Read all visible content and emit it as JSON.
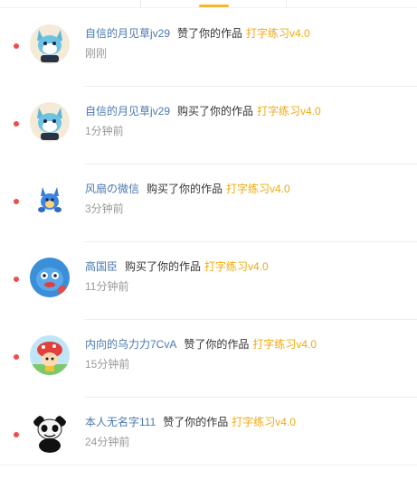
{
  "notifications": [
    {
      "username": "自信的月见草jv29",
      "action": "赞了你的作品",
      "work": "打字练习v4.0",
      "time": "刚刚",
      "avatar": "cartoon-fox-avatar-icon"
    },
    {
      "username": "自信的月见草jv29",
      "action": "购买了你的作品",
      "work": "打字练习v4.0",
      "time": "1分钟前",
      "avatar": "cartoon-fox-avatar-icon"
    },
    {
      "username": "风扇の微信",
      "action": "购买了你的作品",
      "work": "打字练习v4.0",
      "time": "3分钟前",
      "avatar": "blue-creature-avatar-icon"
    },
    {
      "username": "高国臣",
      "action": "购买了你的作品",
      "work": "打字练习v4.0",
      "time": "11分钟前",
      "avatar": "blue-cartoon-avatar-icon"
    },
    {
      "username": "内向的乌力力7CvA",
      "action": "赞了你的作品",
      "work": "打字练习v4.0",
      "time": "15分钟前",
      "avatar": "red-hat-mushroom-avatar-icon"
    },
    {
      "username": "本人无名字111",
      "action": "赞了你的作品",
      "work": "打字练习v4.0",
      "time": "24分钟前",
      "avatar": "panda-meme-avatar-icon"
    }
  ],
  "colors": {
    "username": "#4a78b2",
    "work": "#f0a90f",
    "unread_dot": "#f04c4c",
    "tab_active": "#f5b731"
  }
}
